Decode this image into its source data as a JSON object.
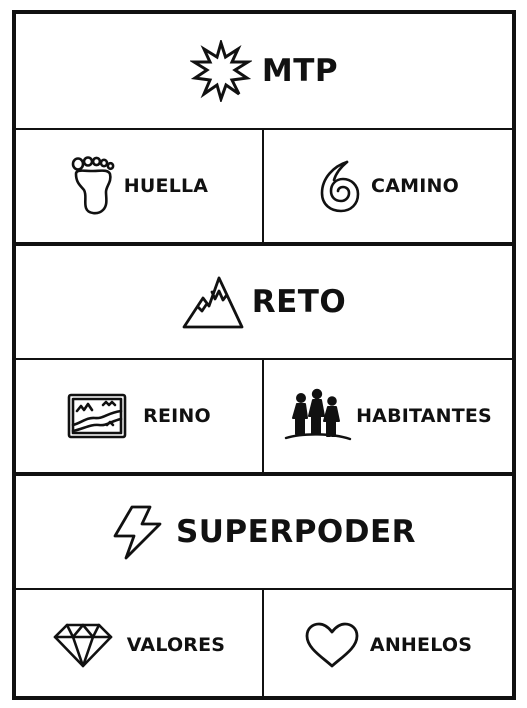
{
  "sections": [
    {
      "main": {
        "label": "MTP",
        "icon": "star-burst-icon"
      },
      "left": {
        "label": "HUELLA",
        "icon": "footprint-icon"
      },
      "right": {
        "label": "CAMINO",
        "icon": "spiral-icon"
      }
    },
    {
      "main": {
        "label": "RETO",
        "icon": "mountain-icon"
      },
      "left": {
        "label": "REINO",
        "icon": "map-icon"
      },
      "right": {
        "label": "HABITANTES",
        "icon": "people-group-icon"
      }
    },
    {
      "main": {
        "label": "SUPERPODER",
        "icon": "lightning-icon"
      },
      "left": {
        "label": "VALORES",
        "icon": "diamond-icon"
      },
      "right": {
        "label": "ANHELOS",
        "icon": "heart-icon"
      }
    }
  ],
  "colors": {
    "line": "#111111",
    "background": "#ffffff"
  }
}
